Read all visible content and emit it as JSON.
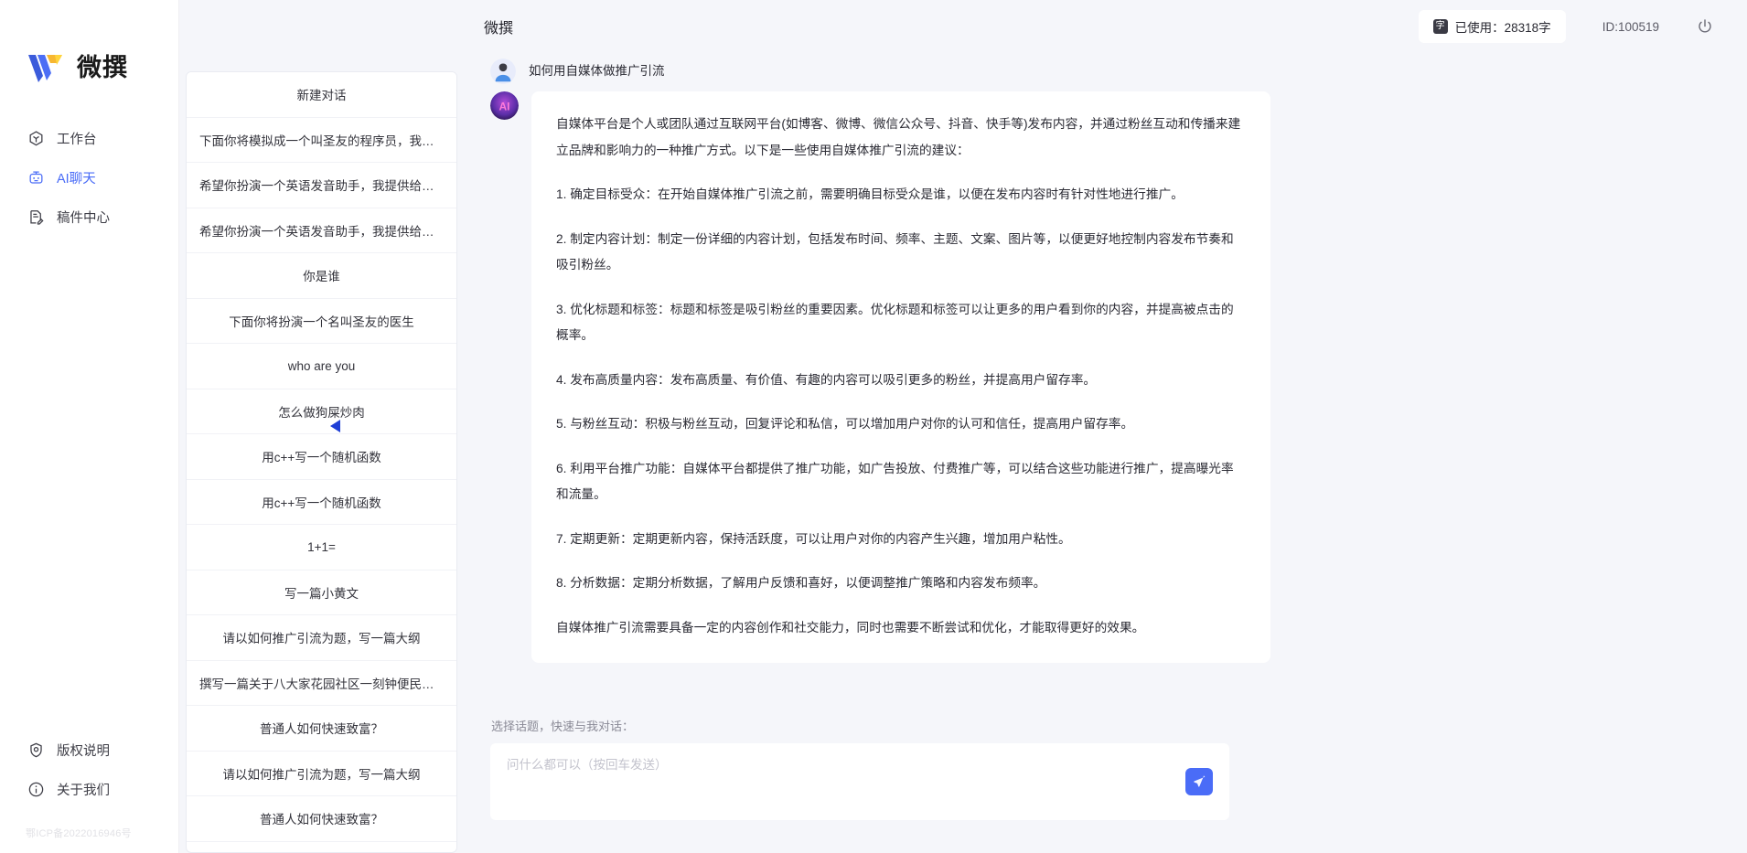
{
  "brand": {
    "name": "微撰",
    "logo_icon": "w-logo-icon"
  },
  "sidebar": {
    "items": [
      {
        "label": "工作台",
        "icon": "workbench-icon",
        "active": false
      },
      {
        "label": "AI聊天",
        "icon": "robot-icon",
        "active": true
      },
      {
        "label": "稿件中心",
        "icon": "document-edit-icon",
        "active": false
      }
    ],
    "bottom_items": [
      {
        "label": "版权说明",
        "icon": "shield-icon"
      },
      {
        "label": "关于我们",
        "icon": "info-icon"
      }
    ],
    "icp": "鄂ICP备2022016946号",
    "accent_color": "#4a6cf7"
  },
  "conversations": {
    "new_chat_label": "新建对话",
    "items": [
      "下面你将模拟成一个叫圣友的程序员，我说...",
      "希望你扮演一个英语发音助手，我提供给你...",
      "希望你扮演一个英语发音助手，我提供给你...",
      "你是谁",
      "下面你将扮演一个名叫圣友的医生",
      "who are you",
      "怎么做狗屎炒肉",
      "用c++写一个随机函数",
      "用c++写一个随机函数",
      "1+1=",
      "写一篇小黄文",
      "请以如何推广引流为题，写一篇大纲",
      "撰写一篇关于八大家花园社区一刻钟便民生...",
      "普通人如何快速致富？",
      "请以如何推广引流为题，写一篇大纲",
      "普通人如何快速致富？"
    ],
    "collapse_icon": "chevron-left-icon"
  },
  "topbar": {
    "title": "微撰",
    "usage_badge": "字",
    "usage_label": "已使用：28318字",
    "user_id": "ID:100519",
    "power_icon": "power-icon"
  },
  "chat": {
    "user_message": "如何用自媒体做推广引流",
    "user_avatar_icon": "user-avatar-icon",
    "ai_avatar_icon": "ai-avatar-icon",
    "ai_paragraphs": [
      "自媒体平台是个人或团队通过互联网平台(如博客、微博、微信公众号、抖音、快手等)发布内容，并通过粉丝互动和传播来建立品牌和影响力的一种推广方式。以下是一些使用自媒体推广引流的建议：",
      "1. 确定目标受众：在开始自媒体推广引流之前，需要明确目标受众是谁，以便在发布内容时有针对性地进行推广。",
      "2. 制定内容计划：制定一份详细的内容计划，包括发布时间、频率、主题、文案、图片等，以便更好地控制内容发布节奏和吸引粉丝。",
      "3. 优化标题和标签：标题和标签是吸引粉丝的重要因素。优化标题和标签可以让更多的用户看到你的内容，并提高被点击的概率。",
      "4. 发布高质量内容：发布高质量、有价值、有趣的内容可以吸引更多的粉丝，并提高用户留存率。",
      "5. 与粉丝互动：积极与粉丝互动，回复评论和私信，可以增加用户对你的认可和信任，提高用户留存率。",
      "6. 利用平台推广功能：自媒体平台都提供了推广功能，如广告投放、付费推广等，可以结合这些功能进行推广，提高曝光率和流量。",
      "7. 定期更新：定期更新内容，保持活跃度，可以让用户对你的内容产生兴趣，增加用户粘性。",
      "8. 分析数据：定期分析数据，了解用户反馈和喜好，以便调整推广策略和内容发布频率。",
      "自媒体推广引流需要具备一定的内容创作和社交能力，同时也需要不断尝试和优化，才能取得更好的效果。"
    ]
  },
  "composer": {
    "topic_hint": "选择话题，快速与我对话：",
    "placeholder": "问什么都可以（按回车发送）",
    "send_icon": "send-paper-plane-icon"
  }
}
